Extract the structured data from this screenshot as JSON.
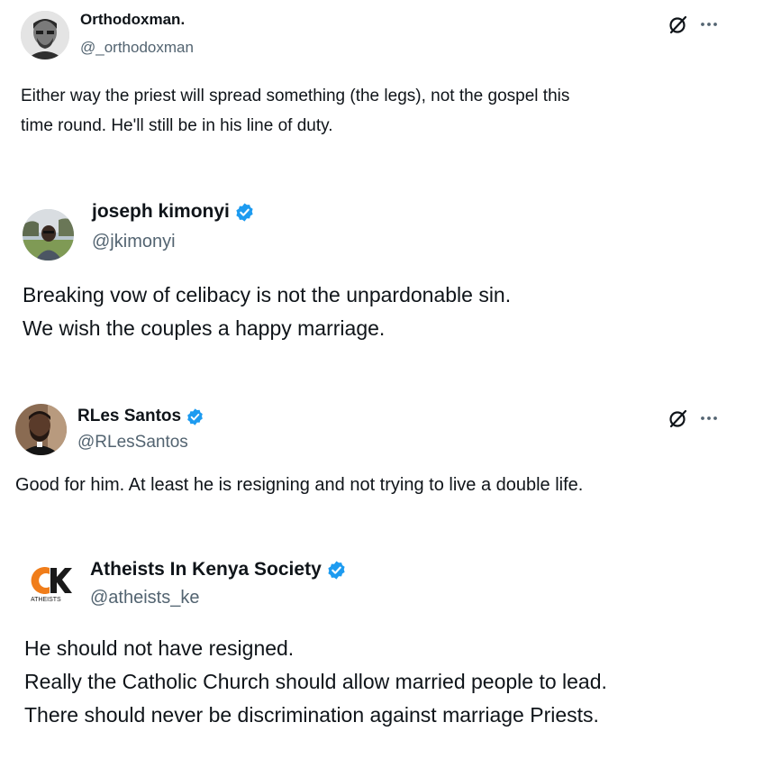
{
  "tweets": [
    {
      "name": "Orthodoxman.",
      "handle": "@_orthodoxman",
      "verified": false,
      "lines": [
        "Either way the priest will spread something (the legs), not the gospel this",
        "time round. He'll still be in his line of duty."
      ],
      "actions": {
        "grok_icon": "slashed-circle-icon",
        "more_icon": "more-icon"
      }
    },
    {
      "name": "joseph kimonyi",
      "handle": "@jkimonyi",
      "verified": true,
      "lines": [
        "Breaking vow of celibacy is not the unpardonable sin.",
        "We wish the couples a happy marriage."
      ]
    },
    {
      "name": "RLes Santos",
      "handle": "@RLesSantos",
      "verified": true,
      "lines": [
        "Good for him. At least he is resigning and not trying to live a double life."
      ],
      "actions": {
        "grok_icon": "slashed-circle-icon",
        "more_icon": "more-icon"
      }
    },
    {
      "name": "Atheists In Kenya Society",
      "handle": "@atheists_ke",
      "verified": true,
      "logo_text": "ATHEISTS",
      "lines": [
        "He should not have resigned.",
        "Really the Catholic Church should allow married people to lead.",
        "There should never be discrimination against marriage Priests."
      ]
    }
  ],
  "colors": {
    "text": "#0f1419",
    "secondary": "#536471",
    "verified_blue": "#1d9bf0",
    "logo_orange": "#f07d1a",
    "logo_dark": "#1a1a1a"
  }
}
